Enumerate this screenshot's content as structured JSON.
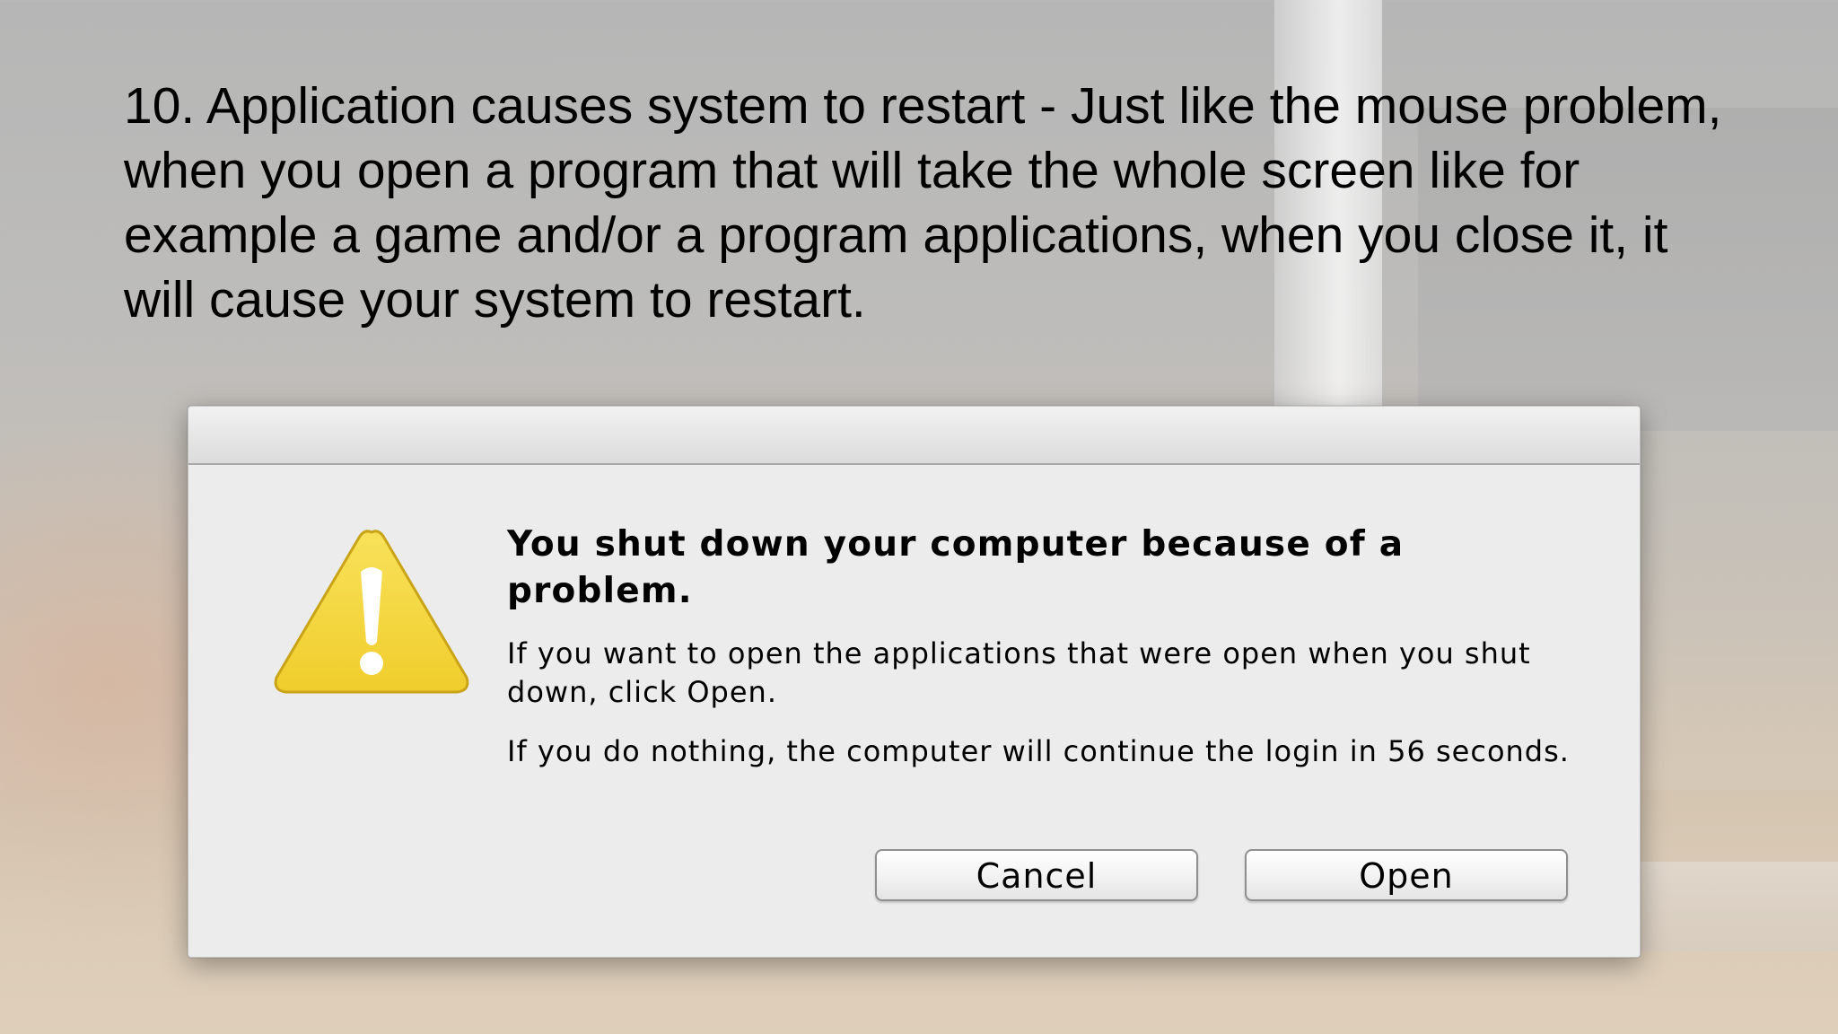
{
  "slide": {
    "text": "10. Application causes system to restart - Just like the mouse problem, when you open a program that will take the whole screen like for example a game and/or a program applications, when you close it, it will cause your system to restart."
  },
  "dialog": {
    "icon": "warning-triangle-icon",
    "icon_color": "#f3d43a",
    "heading": "You shut down your computer because of a problem.",
    "body_1": "If you want to open the applications that were open when you shut down, click Open.",
    "body_2": "If you do nothing, the computer will continue the login in 56 seconds.",
    "buttons": {
      "cancel_label": "Cancel",
      "open_label": "Open"
    }
  }
}
